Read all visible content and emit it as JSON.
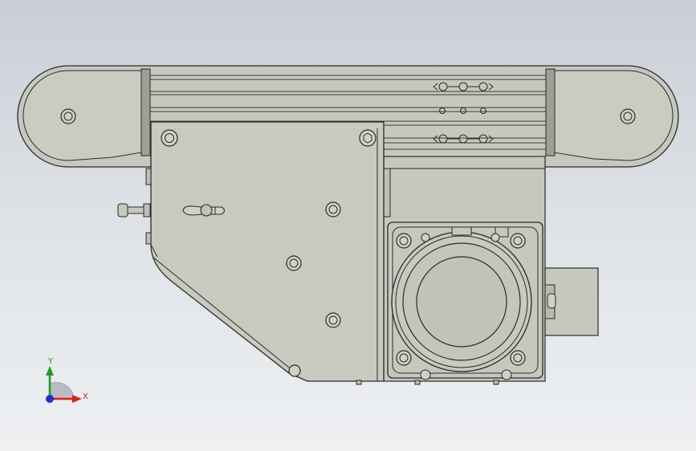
{
  "viewport": {
    "background_top": "#c9ced6",
    "background_bottom": "#eef0f2"
  },
  "colors": {
    "part_fill": "#c7c8bd",
    "part_fill_light": "#d0d1c6",
    "part_dark": "#a9aa9f",
    "edge": "#2a2a2a",
    "axis_x": "#d62020",
    "axis_y": "#1f9a2c",
    "axis_z": "#1f2fd6"
  },
  "triad": {
    "x_label": "X",
    "y_label": "Y"
  },
  "model": {
    "name_icon": "conveyor-assembly-front-view"
  }
}
